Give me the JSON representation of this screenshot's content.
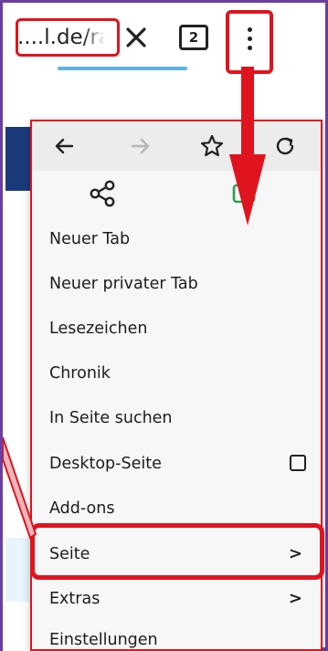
{
  "browser": {
    "url_text": "....l.de/ra",
    "tab_count": "2",
    "accent_progress": "#5fb1e8",
    "highlight_color": "#e0141e",
    "frame_color": "#6b3fa0"
  },
  "menu": {
    "toolbar_icons": [
      "back-icon",
      "forward-icon",
      "star-icon",
      "reload-icon"
    ],
    "second_row_icons": [
      "share-icon",
      "add-icon"
    ],
    "items": [
      {
        "label": "Neuer Tab"
      },
      {
        "label": "Neuer privater Tab"
      },
      {
        "label": "Lesezeichen"
      },
      {
        "label": "Chronik"
      },
      {
        "label": "In Seite suchen"
      },
      {
        "label": "Desktop-Seite"
      },
      {
        "label": "Add-ons"
      },
      {
        "label": "Seite"
      },
      {
        "label": "Extras"
      },
      {
        "label": "Einstellungen"
      }
    ],
    "chevron_glyph": ">"
  }
}
